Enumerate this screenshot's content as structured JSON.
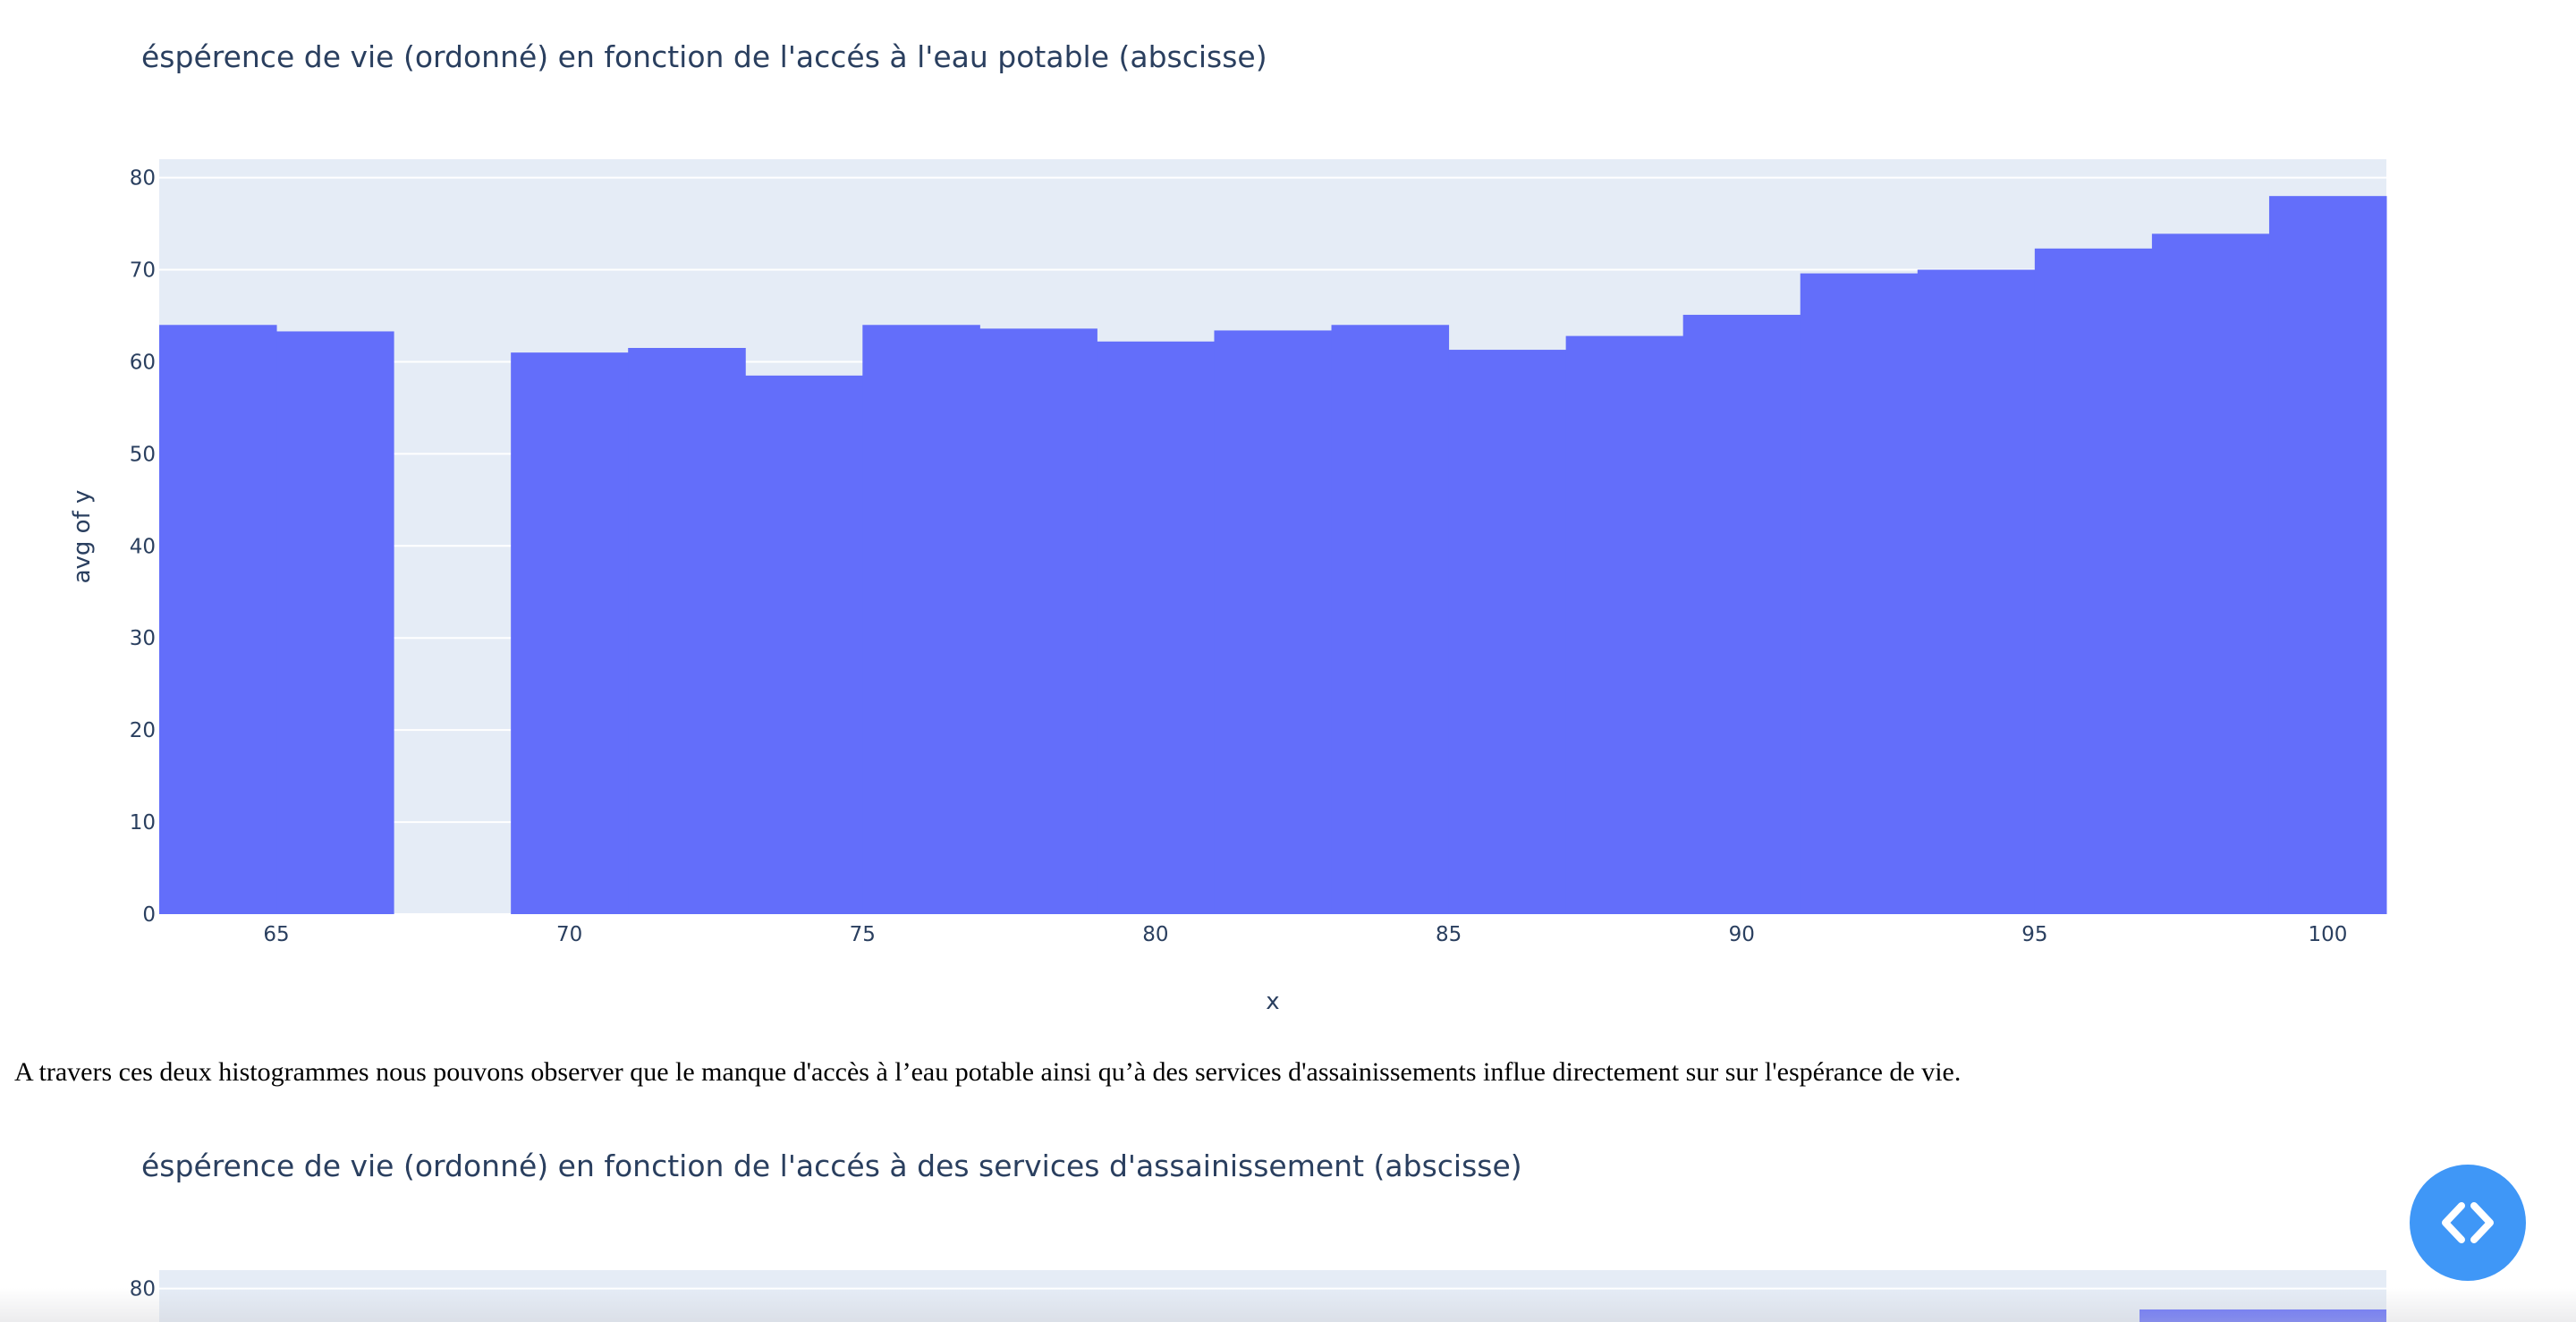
{
  "charts": [
    {
      "title": "éspérence de vie (ordonné) en fonction de l'accés à l'eau potable (abscisse)"
    },
    {
      "title": "éspérence de vie (ordonné) en fonction de l'accés à des services d'assainissement (abscisse)"
    }
  ],
  "paragraph": "A travers ces deux histogrammes nous pouvons observer que le manque d'accès à l’eau potable ainsi qu’à des services d'assainissements influe directement sur sur l'espérance de vie.",
  "code_toggle": {
    "icon": "code-brackets-icon"
  },
  "colors": {
    "bar": "#636efa",
    "plot_background": "#e5ecf6",
    "text": "#2a3f5f",
    "button": "#3f97f7"
  },
  "chart_data": [
    {
      "type": "bar",
      "title": "éspérence de vie (ordonné) en fonction de l'accés à l'eau potable (abscisse)",
      "xlabel": "x",
      "ylabel": "avg of y",
      "bin_width": 2,
      "xlim": [
        63,
        101
      ],
      "ylim": [
        0,
        82
      ],
      "x_ticks": [
        65,
        70,
        75,
        80,
        85,
        90,
        95,
        100
      ],
      "y_ticks": [
        0,
        10,
        20,
        30,
        40,
        50,
        60,
        70,
        80
      ],
      "x": [
        64,
        66,
        70,
        72,
        74,
        76,
        78,
        80,
        82,
        84,
        86,
        88,
        90,
        92,
        94,
        96,
        98,
        100
      ],
      "values": [
        64.0,
        63.3,
        61.0,
        61.5,
        58.5,
        64.0,
        63.6,
        62.2,
        63.4,
        64.0,
        61.3,
        62.8,
        65.1,
        69.6,
        70.0,
        72.3,
        73.9,
        78.0
      ],
      "grid": true
    },
    {
      "type": "bar",
      "title": "éspérence de vie (ordonné) en fonction de l'accés à des services d'assainissement (abscisse)",
      "y_ticks": [
        80
      ],
      "ylim": [
        0,
        82
      ],
      "visible_partial": true,
      "grid": true
    }
  ]
}
